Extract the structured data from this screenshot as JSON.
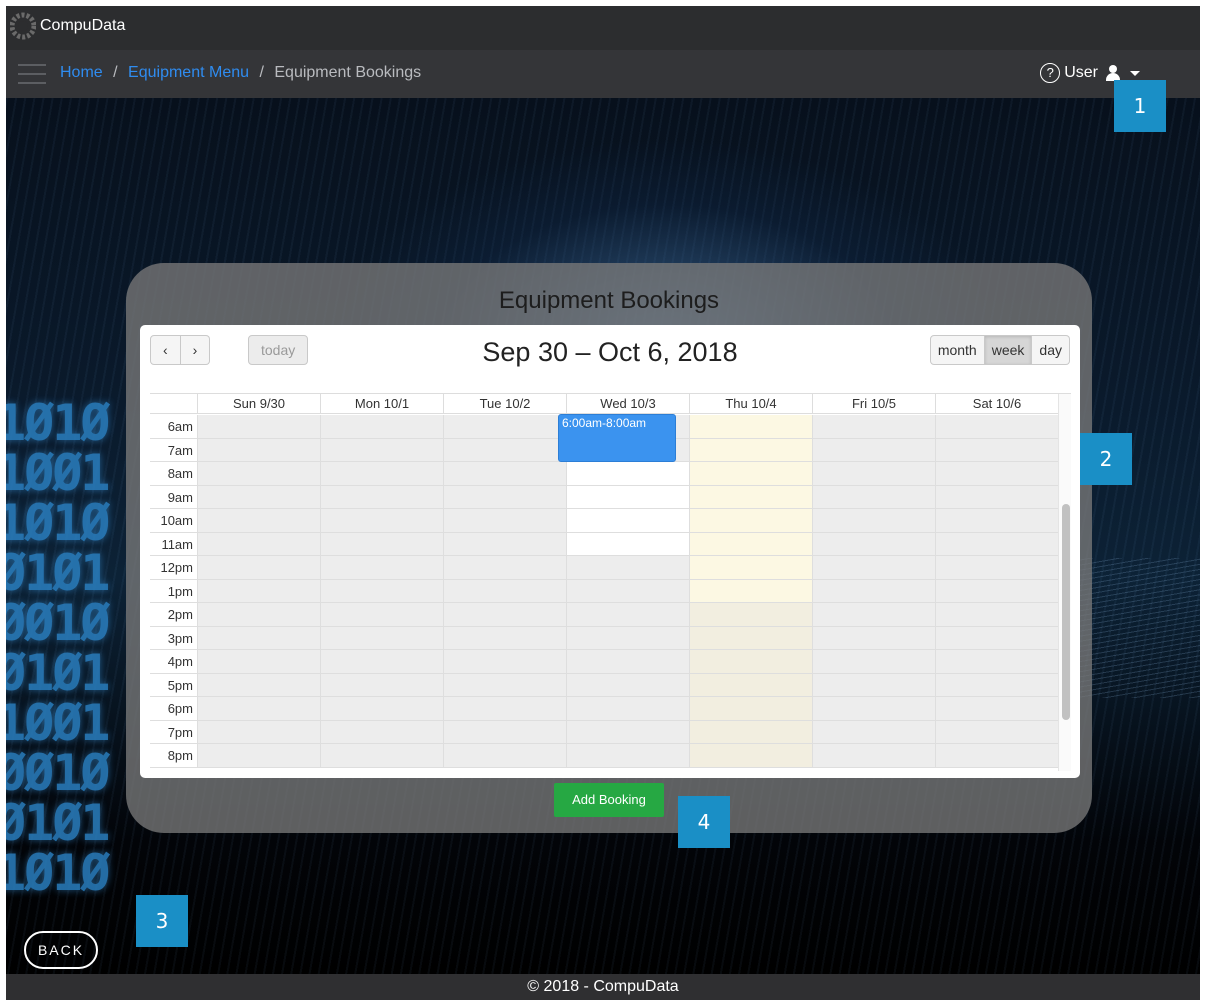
{
  "app": {
    "brand": "CompuData"
  },
  "breadcrumb": {
    "home": "Home",
    "equipment_menu": "Equipment Menu",
    "current": "Equipment Bookings",
    "separator": "/"
  },
  "user": {
    "help_glyph": "?",
    "label": "User"
  },
  "callouts": {
    "c1": "1",
    "c2": "2",
    "c3": "3",
    "c4": "4"
  },
  "panel": {
    "title": "Equipment Bookings"
  },
  "calendar": {
    "prev_glyph": "‹",
    "next_glyph": "›",
    "today_label": "today",
    "range_title": "Sep 30 – Oct 6, 2018",
    "views": {
      "month": "month",
      "week": "week",
      "day": "day",
      "active": "week"
    },
    "days": [
      "Sun 9/30",
      "Mon 10/1",
      "Tue 10/2",
      "Wed 10/3",
      "Thu 10/4",
      "Fri 10/5",
      "Sat 10/6"
    ],
    "hours": [
      "6am",
      "7am",
      "8am",
      "9am",
      "10am",
      "11am",
      "12pm",
      "1pm",
      "2pm",
      "3pm",
      "4pm",
      "5pm",
      "6pm",
      "7pm",
      "8pm"
    ],
    "events": [
      {
        "label": "6:00am-8:00am",
        "day": "Wed 10/3"
      }
    ],
    "colors": {
      "event": "#3b93ef",
      "today_highlight": "#fcf8e3",
      "unavailable": "#ededed"
    }
  },
  "actions": {
    "add_booking": "Add Booking",
    "back": "BACK"
  },
  "footer": {
    "text": "© 2018 - CompuData"
  }
}
